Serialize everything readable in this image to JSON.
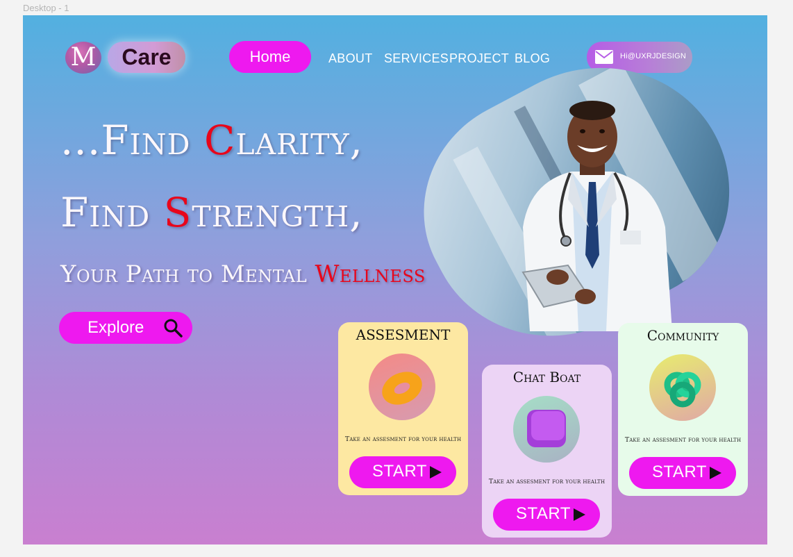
{
  "canvas": {
    "label": "Desktop - 1"
  },
  "logo": {
    "mark": "M",
    "name": "Care"
  },
  "nav": {
    "home": "Home",
    "links": [
      "ABOUT",
      "SERVICES",
      "PROJECT",
      "BLOG"
    ]
  },
  "contact": {
    "email": "Hi@UXRJDESIGN",
    "icon": "mail-icon"
  },
  "hero": {
    "line1_prefix": "...Find ",
    "line1_accent": "C",
    "line1_suffix": "larity,",
    "line2_accent_prefix": "Find ",
    "line2_accent": "S",
    "line2_suffix": "trength,",
    "line3_prefix": "Your Path to Mental ",
    "line3_accent": "Wellness",
    "explore_label": "Explore",
    "explore_icon": "search-icon",
    "image": "doctor-photo"
  },
  "cards": [
    {
      "title": "ASSESMENT",
      "desc": "Take an assesment for your health",
      "button": "START",
      "art": "orange-torus-icon"
    },
    {
      "title": "Chat Boat",
      "desc": "Take an assesment for your health",
      "button": "START",
      "art": "purple-cube-icon"
    },
    {
      "title": "Community",
      "desc": "Take an assesment for your health",
      "button": "START",
      "art": "green-knot-icon"
    }
  ],
  "colors": {
    "accent": "#ee19ef",
    "highlight": "#e8061b",
    "card_assessment": "#fde8a2",
    "card_chat": "#ecd4f5",
    "card_community": "#e7fbea"
  }
}
